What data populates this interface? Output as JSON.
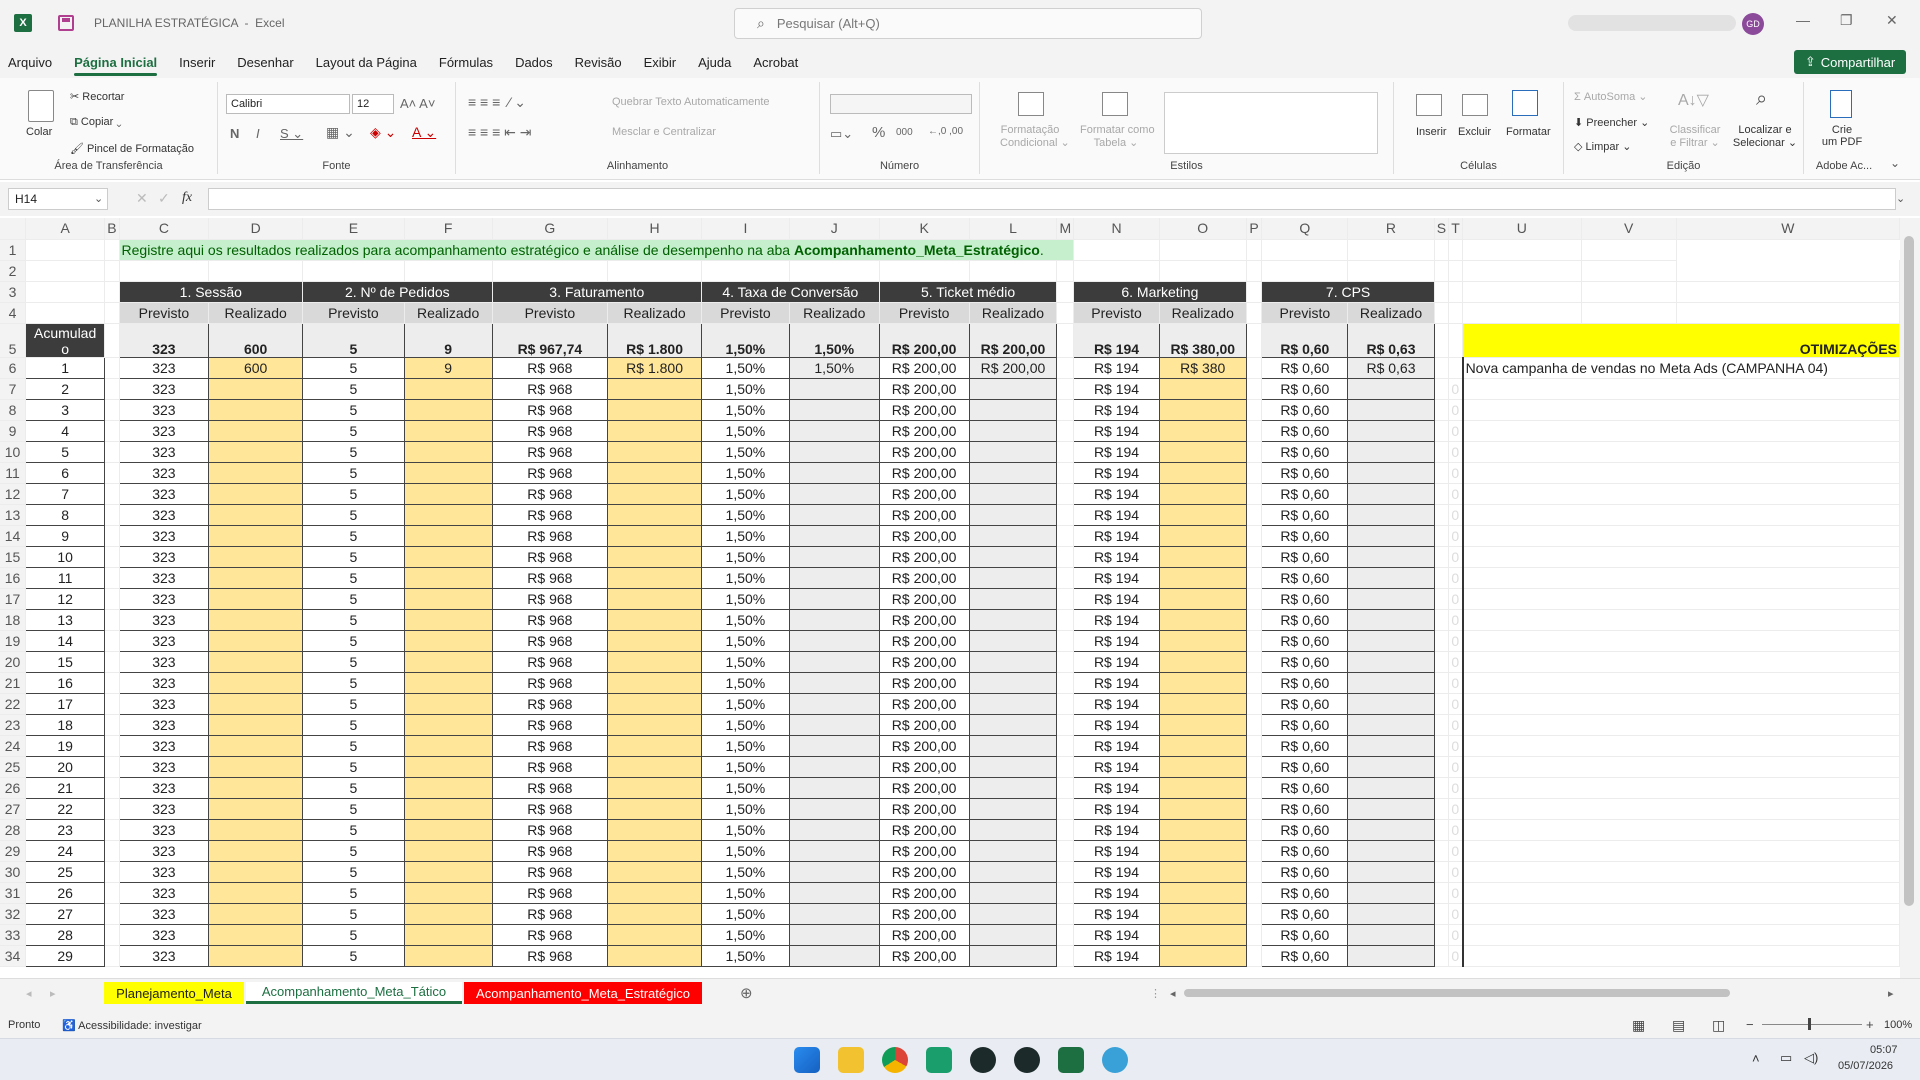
{
  "titlebar": {
    "file_title": "PLANILHA ESTRATÉGICA",
    "app_name": "Excel",
    "search_placeholder": "Pesquisar (Alt+Q)",
    "avatar_initials": "GD"
  },
  "menu": {
    "items": [
      "Arquivo",
      "Página Inicial",
      "Inserir",
      "Desenhar",
      "Layout da Página",
      "Fórmulas",
      "Dados",
      "Revisão",
      "Exibir",
      "Ajuda",
      "Acrobat"
    ],
    "share_label": "Compartilhar"
  },
  "ribbon": {
    "clipboard": {
      "paste": "Colar",
      "cut": "Recortar",
      "copy": "Copiar",
      "painter": "Pincel de Formatação",
      "group": "Área de Transferência"
    },
    "font": {
      "name": "Calibri",
      "size": "12",
      "group": "Fonte"
    },
    "alignment": {
      "wrap": "Quebrar Texto Automaticamente",
      "merge": "Mesclar e Centralizar",
      "group": "Alinhamento"
    },
    "number": {
      "group": "Número",
      "percent": "%",
      "thousands": "000"
    },
    "styles": {
      "cond1": "Formatação",
      "cond2": "Condicional",
      "table1": "Formatar como",
      "table2": "Tabela",
      "group": "Estilos"
    },
    "cells": {
      "insert": "Inserir",
      "delete": "Excluir",
      "format": "Formatar",
      "group": "Células"
    },
    "editing": {
      "autosum": "AutoSoma",
      "fill": "Preencher",
      "clear": "Limpar",
      "sort1": "Classificar",
      "sort2": "e Filtrar",
      "find1": "Localizar e",
      "find2": "Selecionar",
      "group": "Edição"
    },
    "adobe": {
      "create1": "Crie",
      "create2": "um PDF",
      "group": "Adobe Ac..."
    }
  },
  "formula_bar": {
    "name_box": "H14",
    "fx": "fx",
    "formula": ""
  },
  "sheet": {
    "banner_prefix": "Registre aqui os resultados realizados para acompanhamento estratégico e análise de desempenho na aba ",
    "banner_bold": "Acompanhamento_Meta_Estratégico",
    "banner_suffix": ".",
    "row5_a": "Acumulad",
    "row5_a2": "o",
    "optimizations_label": "OTIMIZAÇÕES",
    "sections": [
      "1. Sessão",
      "2. Nº de Pedidos",
      "3. Faturamento",
      "4. Taxa de Conversão",
      "5. Ticket médio",
      "6. Marketing",
      "7. CPS"
    ],
    "previsto": "Previsto",
    "realizado": "Realizado",
    "cumulative": [
      "323",
      "600",
      "5",
      "9",
      "R$ 967,74",
      "R$ 1.800",
      "1,50%",
      "1,50%",
      "R$ 200,00",
      "R$ 200,00",
      "R$ 194",
      "R$ 380,00",
      "R$ 0,60",
      "R$ 0,63"
    ],
    "row1": {
      "num": "1",
      "sess_r": "600",
      "ped_r": "9",
      "fat_r": "R$ 1.800",
      "conv_r": "1,50%",
      "tick_r": "R$ 200,00",
      "mkt_r": "R$ 380",
      "cps_r": "R$ 0,63",
      "note": "Nova campanha de vendas no Meta Ads (CAMPANHA 04)"
    },
    "plan": {
      "sessao": "323",
      "pedidos": "5",
      "fat": "R$ 968",
      "conv": "1,50%",
      "ticket": "R$ 200,00",
      "mkt": "R$ 194",
      "cps": "R$ 0,60"
    },
    "zero": "0",
    "column_letters": [
      "A",
      "B",
      "C",
      "D",
      "E",
      "F",
      "G",
      "H",
      "I",
      "J",
      "K",
      "L",
      "M",
      "N",
      "O",
      "P",
      "Q",
      "R",
      "S",
      "T",
      "U",
      "V",
      "W"
    ],
    "row_numbers": [
      "1",
      "2",
      "3",
      "4",
      "5",
      "6",
      "7",
      "8",
      "9",
      "10",
      "11",
      "12",
      "13",
      "14",
      "15",
      "16",
      "17",
      "18",
      "19",
      "20",
      "21",
      "22",
      "23",
      "24",
      "25",
      "26",
      "27",
      "28",
      "29",
      "30",
      "31",
      "32",
      "33",
      "34"
    ],
    "day_numbers": [
      "1",
      "2",
      "3",
      "4",
      "5",
      "6",
      "7",
      "8",
      "9",
      "10",
      "11",
      "12",
      "13",
      "14",
      "15",
      "16",
      "17",
      "18",
      "19",
      "20",
      "21",
      "22",
      "23",
      "24",
      "25",
      "26",
      "27",
      "28",
      "29"
    ]
  },
  "tabs": [
    {
      "label": "Planejamento_Meta",
      "color": "#ffff00",
      "text": "#222222"
    },
    {
      "label": "Acompanhamento_Meta_Tático",
      "color": "#ffffff",
      "text": "#1d6f42"
    },
    {
      "label": "Acompanhamento_Meta_Estratégico",
      "color": "#ff0000",
      "text": "#ffffff"
    }
  ],
  "status": {
    "ready": "Pronto",
    "accessibility": "Acessibilidade: investigar",
    "zoom": "100%"
  },
  "taskbar": {
    "time": "05:07",
    "date": "05/07/2026"
  },
  "colors": {
    "accent": "#1d6f42",
    "header_dark": "#3c3c3c",
    "realizado_fill": "#ffe699",
    "banner_fill": "#c6efce"
  }
}
